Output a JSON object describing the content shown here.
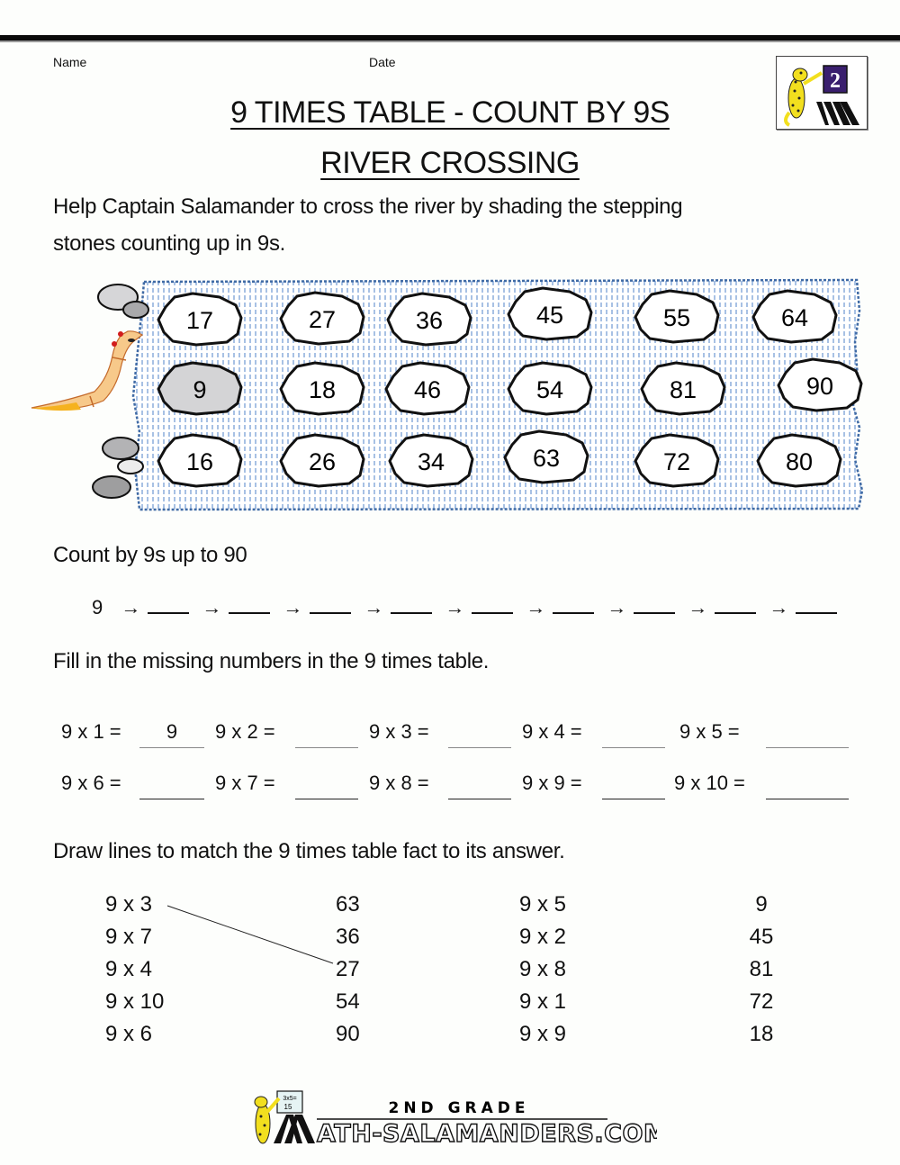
{
  "header": {
    "name_label": "Name",
    "date_label": "Date",
    "grade_badge": "2",
    "title": "9 TIMES TABLE - COUNT BY 9S",
    "subtitle": "RIVER CROSSING"
  },
  "instructions": {
    "river_line1": "Help Captain Salamander to cross the river by shading the stepping",
    "river_line2": "stones counting up in 9s."
  },
  "river": {
    "character": "salamander-icon",
    "water_color": "#4a7bbf",
    "shaded_color": "#d4d4d6",
    "stones": [
      {
        "row": 0,
        "col": 0,
        "value": "17",
        "shaded": false
      },
      {
        "row": 0,
        "col": 1,
        "value": "27",
        "shaded": false
      },
      {
        "row": 0,
        "col": 2,
        "value": "36",
        "shaded": false
      },
      {
        "row": 0,
        "col": 3,
        "value": "45",
        "shaded": false
      },
      {
        "row": 0,
        "col": 4,
        "value": "55",
        "shaded": false
      },
      {
        "row": 0,
        "col": 5,
        "value": "64",
        "shaded": false
      },
      {
        "row": 1,
        "col": 0,
        "value": "9",
        "shaded": true
      },
      {
        "row": 1,
        "col": 1,
        "value": "18",
        "shaded": false
      },
      {
        "row": 1,
        "col": 2,
        "value": "46",
        "shaded": false
      },
      {
        "row": 1,
        "col": 3,
        "value": "54",
        "shaded": false
      },
      {
        "row": 1,
        "col": 4,
        "value": "81",
        "shaded": false
      },
      {
        "row": 1,
        "col": 5,
        "value": "90",
        "shaded": false
      },
      {
        "row": 2,
        "col": 0,
        "value": "16",
        "shaded": false
      },
      {
        "row": 2,
        "col": 1,
        "value": "26",
        "shaded": false
      },
      {
        "row": 2,
        "col": 2,
        "value": "34",
        "shaded": false
      },
      {
        "row": 2,
        "col": 3,
        "value": "63",
        "shaded": false
      },
      {
        "row": 2,
        "col": 4,
        "value": "72",
        "shaded": false
      },
      {
        "row": 2,
        "col": 5,
        "value": "80",
        "shaded": false
      }
    ]
  },
  "count_section": {
    "heading": "Count by 9s up to 90",
    "start": "9",
    "arrow": "→",
    "blanks": [
      "",
      "",
      "",
      "",
      "",
      "",
      "",
      "",
      "",
      ""
    ]
  },
  "fill_section": {
    "heading": "Fill in the missing numbers in the 9 times table.",
    "facts": [
      {
        "label": "9 x 1 =",
        "answer": "9"
      },
      {
        "label": "9 x 2 =",
        "answer": ""
      },
      {
        "label": "9 x 3 =",
        "answer": ""
      },
      {
        "label": "9 x 4 =",
        "answer": ""
      },
      {
        "label": "9 x 5 =",
        "answer": ""
      },
      {
        "label": "9 x 6 =",
        "answer": ""
      },
      {
        "label": "9 x 7 =",
        "answer": ""
      },
      {
        "label": "9 x 8 =",
        "answer": ""
      },
      {
        "label": "9 x 9 =",
        "answer": ""
      },
      {
        "label": "9 x 10 =",
        "answer": ""
      }
    ]
  },
  "match_section": {
    "heading": "Draw lines to match the 9 times table fact to its answer.",
    "left_facts": [
      "9 x 3",
      "9 x 7",
      "9 x 4",
      "9 x 10",
      "9 x 6"
    ],
    "left_answers": [
      "63",
      "36",
      "27",
      "54",
      "90"
    ],
    "right_facts": [
      "9 x 5",
      "9 x 2",
      "9 x 8",
      "9 x 1",
      "9 x 9"
    ],
    "right_answers": [
      "9",
      "45",
      "81",
      "72",
      "18"
    ],
    "example_match": {
      "from": "9 x 3",
      "to": "27"
    }
  },
  "footer": {
    "grade_text": "2ND GRADE",
    "site_text": "ATH-SALAMANDERS.COM",
    "board_text_top": "3x5=",
    "board_text_bottom": "15"
  }
}
